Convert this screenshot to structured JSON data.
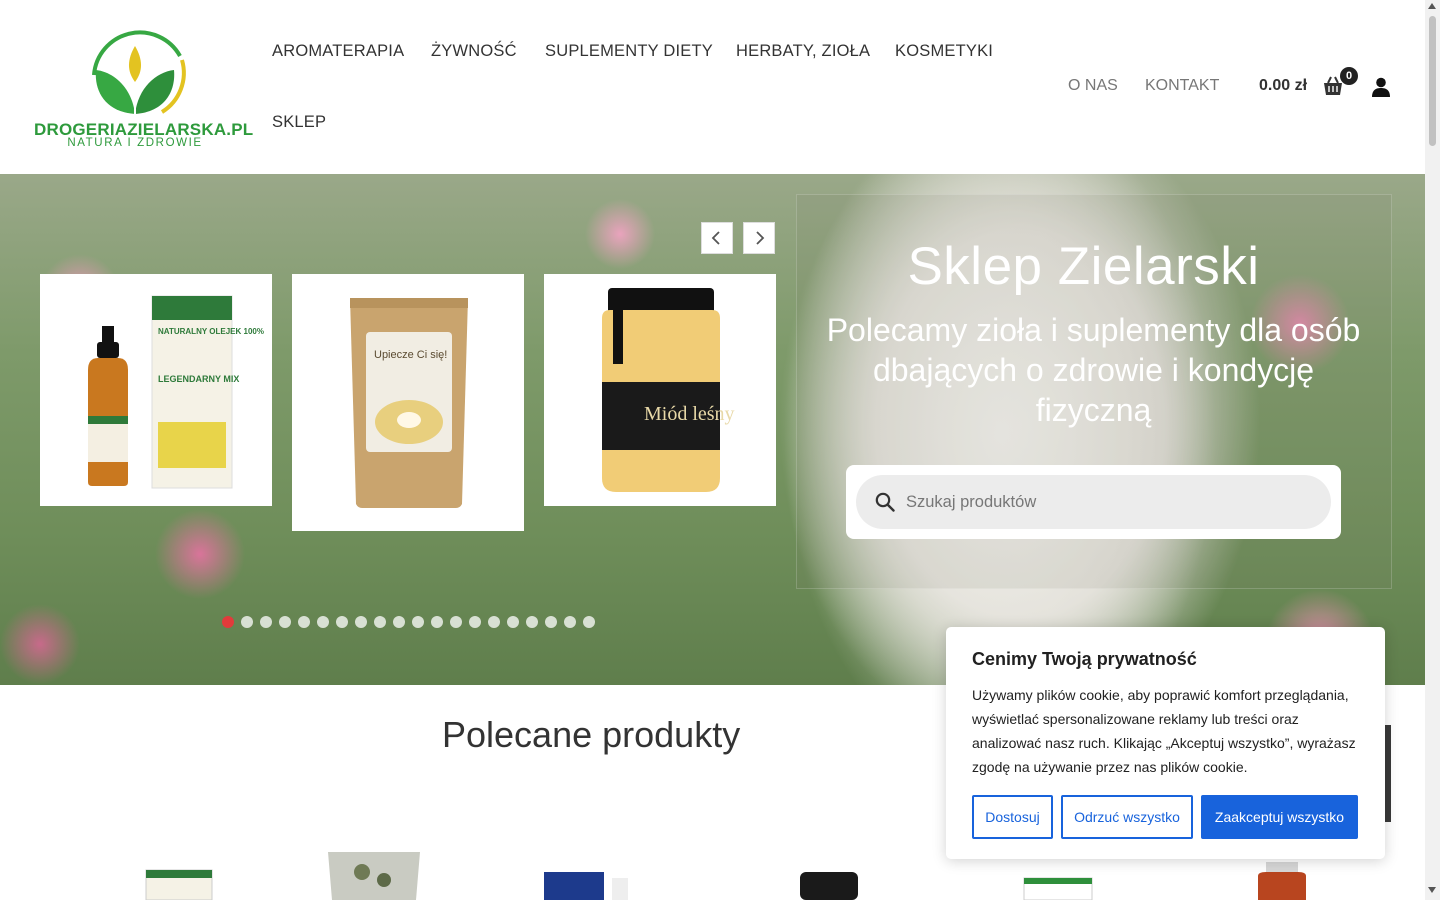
{
  "brand": {
    "name": "DROGERIAZIELARSKA.PL",
    "tagline": "NATURA I ZDROWIE"
  },
  "nav": {
    "main": [
      "AROMATERAPIA",
      "ŻYWNOŚĆ",
      "SUPLEMENTY DIETY",
      "HERBATY, ZIOŁA",
      "KOSMETYKI",
      "SKLEP"
    ],
    "secondary": [
      "O NAS",
      "KONTAKT"
    ]
  },
  "cart": {
    "total": "0.00 zł",
    "count": "0"
  },
  "hero": {
    "title": "Sklep Zielarski",
    "subtitle": "Polecamy zioła i suplementy dla osób dbających o zdrowie i kondycję fizyczną",
    "search_placeholder": "Szukaj produktów",
    "slides_total": 20,
    "active_slide": 1,
    "products": [
      {
        "label_top": "NATURALNY OLEJEK 100%",
        "label_main": "LEGENDARNY MIX"
      },
      {
        "label_main": "Upiecze Ci się!"
      },
      {
        "label_main": "Miód leśny"
      }
    ]
  },
  "featured": {
    "title": "Polecane produkty"
  },
  "cookie": {
    "title": "Cenimy Twoją prywatność",
    "text": "Używamy plików cookie, aby poprawić komfort przeglądania, wyświetlać spersonalizowane reklamy lub treści oraz analizować nasz ruch. Klikając „Akceptuj wszystko”, wyrażasz zgodę na używanie przez nas plików cookie.",
    "btn_customize": "Dostosuj",
    "btn_reject": "Odrzuć wszystko",
    "btn_accept": "Zaakceptuj wszystko"
  },
  "colors": {
    "brand_green": "#2e9a3c",
    "accent_blue": "#1863dc",
    "active_dot": "#e23b3b"
  }
}
